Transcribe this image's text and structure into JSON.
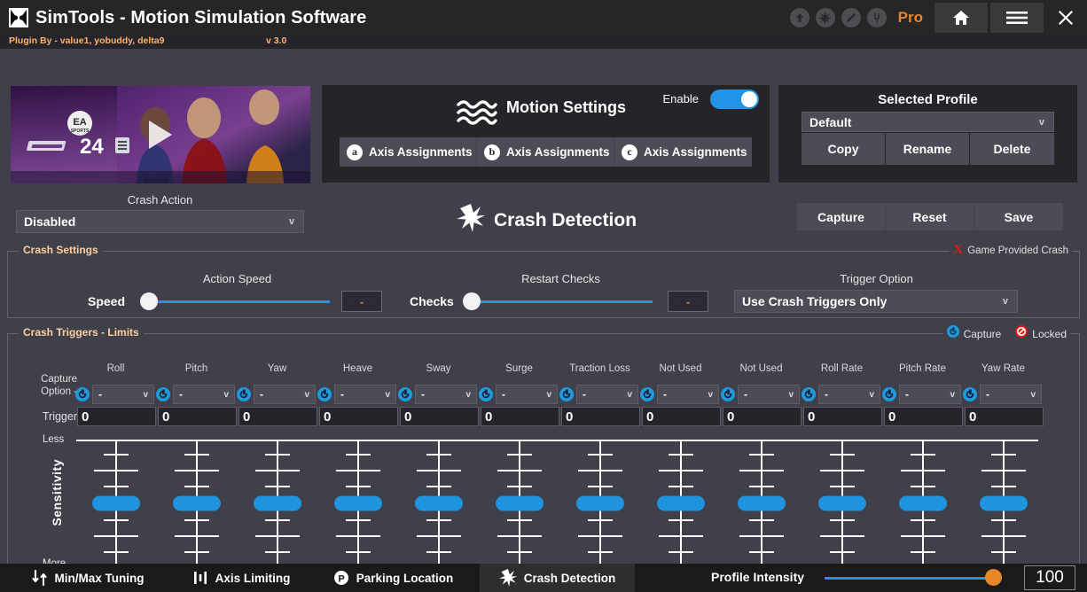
{
  "titlebar": {
    "app_title": "SimTools - Motion Simulation Software",
    "logo_name": "simtools-logo",
    "icons": [
      "upload-icon",
      "burst-icon",
      "pencil-icon",
      "power-plug-icon"
    ],
    "edition": "Pro",
    "edition_suffix": "",
    "home_label": "home-icon",
    "menu_label": "hamburger-icon",
    "close_label": "close-icon"
  },
  "credit": {
    "text": "Plugin By - value1, yobuddy, delta9",
    "version": "v 3.0"
  },
  "game_art": {
    "title": "F1 24",
    "publisher": "EA SPORTS",
    "play_overlay": "play-icon"
  },
  "crash_action": {
    "label": "Crash Action",
    "value": "Disabled",
    "chevron": "v"
  },
  "motion_settings": {
    "title": "Motion Settings",
    "icon": "wave-icon",
    "enable_label": "Enable",
    "enable_state": true,
    "axis_buttons": [
      {
        "badge": "a",
        "label": "Axis Assignments"
      },
      {
        "badge": "b",
        "label": "Axis Assignments"
      },
      {
        "badge": "c",
        "label": "Axis Assignments"
      }
    ]
  },
  "crash_detection_header": {
    "title": "Crash Detection",
    "icon": "burst-icon"
  },
  "profile": {
    "title": "Selected Profile",
    "selected": "Default",
    "chevron": "v",
    "buttons": [
      "Copy",
      "Rename",
      "Delete"
    ],
    "action_buttons": [
      "Capture",
      "Reset",
      "Save"
    ]
  },
  "crash_settings": {
    "legend": "Crash Settings",
    "game_provided": {
      "mark": "X",
      "label": "Game Provided Crash"
    },
    "action_speed": {
      "group_label": "Action Speed",
      "slider_label": "Speed",
      "value": "-",
      "percent": 0
    },
    "restart_checks": {
      "group_label": "Restart Checks",
      "slider_label": "Checks",
      "value": "-",
      "percent": 0
    },
    "trigger_option": {
      "label": "Trigger Option",
      "value": "Use Crash Triggers Only",
      "chevron": "v"
    }
  },
  "crash_triggers": {
    "legend": "Crash Triggers - Limits",
    "capture_label": "Capture",
    "capture_icon": "capture-circle-icon",
    "locked_label": "Locked",
    "locked_icon": "locked-prohibition-icon",
    "capture_option_label_line1": "Capture",
    "capture_option_label_line2": "Option -",
    "trigger_row_label": "Trigger",
    "columns": [
      {
        "header": "Roll",
        "option": "-",
        "trigger": "0",
        "sensitivity": 50
      },
      {
        "header": "Pitch",
        "option": "-",
        "trigger": "0",
        "sensitivity": 50
      },
      {
        "header": "Yaw",
        "option": "-",
        "trigger": "0",
        "sensitivity": 50
      },
      {
        "header": "Heave",
        "option": "-",
        "trigger": "0",
        "sensitivity": 50
      },
      {
        "header": "Sway",
        "option": "-",
        "trigger": "0",
        "sensitivity": 50
      },
      {
        "header": "Surge",
        "option": "-",
        "trigger": "0",
        "sensitivity": 50
      },
      {
        "header": "Traction Loss",
        "option": "-",
        "trigger": "0",
        "sensitivity": 50
      },
      {
        "header": "Not Used",
        "option": "-",
        "trigger": "0",
        "sensitivity": 50
      },
      {
        "header": "Not Used",
        "option": "-",
        "trigger": "0",
        "sensitivity": 50
      },
      {
        "header": "Roll Rate",
        "option": "-",
        "trigger": "0",
        "sensitivity": 50
      },
      {
        "header": "Pitch Rate",
        "option": "-",
        "trigger": "0",
        "sensitivity": 50
      },
      {
        "header": "Yaw Rate",
        "option": "-",
        "trigger": "0",
        "sensitivity": 50
      }
    ],
    "sensitivity_axis_title": "Sensitivity",
    "sensitivity_top_label": "Less",
    "sensitivity_bottom_label": "More"
  },
  "bottom_bar": {
    "tabs": [
      {
        "label": "Min/Max Tuning",
        "icon": "updown-arrows-icon",
        "active": false
      },
      {
        "label": "Axis Limiting",
        "icon": "bars-icon",
        "active": false
      },
      {
        "label": "Parking Location",
        "icon": "parking-icon",
        "active": false
      },
      {
        "label": "Crash Detection",
        "icon": "burst-icon",
        "active": true
      }
    ],
    "profile_intensity_label": "Profile Intensity",
    "profile_intensity_value": "100",
    "profile_intensity_percent": 100
  },
  "colors": {
    "accent_blue": "#2196e8",
    "accent_orange": "#e8862a",
    "panel_dark": "#252529",
    "body_bg": "#3f4049",
    "control_bg": "#4b4c55",
    "danger_red": "#e01a1a"
  }
}
